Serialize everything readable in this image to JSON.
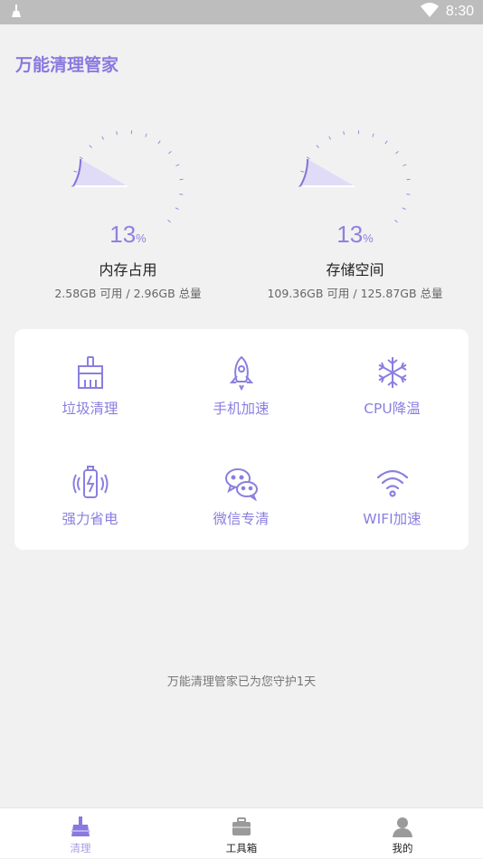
{
  "status_bar": {
    "time": "8:30"
  },
  "app": {
    "title": "万能清理管家"
  },
  "colors": {
    "accent": "#8a78e0",
    "background": "#f1f1f1"
  },
  "memory": {
    "percent": "13",
    "unit": "%",
    "label": "内存占用",
    "detail": "2.58GB 可用 / 2.96GB 总量",
    "level": 0.13
  },
  "storage": {
    "percent": "13",
    "unit": "%",
    "label": "存储空间",
    "detail": "109.36GB 可用 / 125.87GB 总量",
    "level": 0.13
  },
  "tools": [
    {
      "label": "垃圾清理",
      "icon": "broom-icon"
    },
    {
      "label": "手机加速",
      "icon": "rocket-icon"
    },
    {
      "label": "CPU降温",
      "icon": "snowflake-icon"
    },
    {
      "label": "强力省电",
      "icon": "battery-charging-icon"
    },
    {
      "label": "微信专清",
      "icon": "wechat-icon"
    },
    {
      "label": "WIFI加速",
      "icon": "wifi-icon"
    }
  ],
  "guard_text": "万能清理管家已为您守护1天",
  "bottom_nav": [
    {
      "label": "清理",
      "icon": "broom-icon",
      "active": true
    },
    {
      "label": "工具箱",
      "icon": "toolbox-icon",
      "active": false
    },
    {
      "label": "我的",
      "icon": "user-icon",
      "active": false
    }
  ]
}
